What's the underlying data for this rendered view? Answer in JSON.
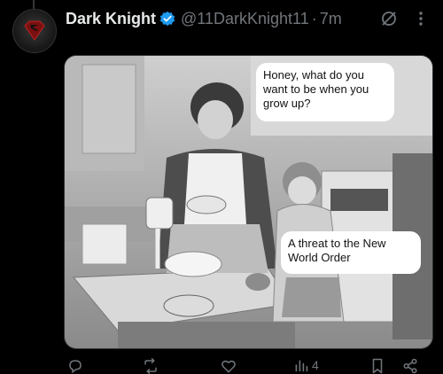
{
  "post": {
    "display_name": "Dark Knight",
    "handle": "@11DarkKnight11",
    "separator": "·",
    "time": "7m"
  },
  "media": {
    "bubble_top": "Honey, what do you want to be when you grow up?",
    "bubble_bottom": "A threat to the New World Order"
  },
  "actions": {
    "views_count": "4"
  },
  "colors": {
    "background": "#000000",
    "verified_badge": "#1d9bf0",
    "muted_text": "#71767b"
  },
  "icons": [
    "verified-badge-icon",
    "grok-icon",
    "more-icon",
    "reply-icon",
    "repost-icon",
    "like-icon",
    "views-icon",
    "bookmark-icon",
    "share-icon"
  ]
}
